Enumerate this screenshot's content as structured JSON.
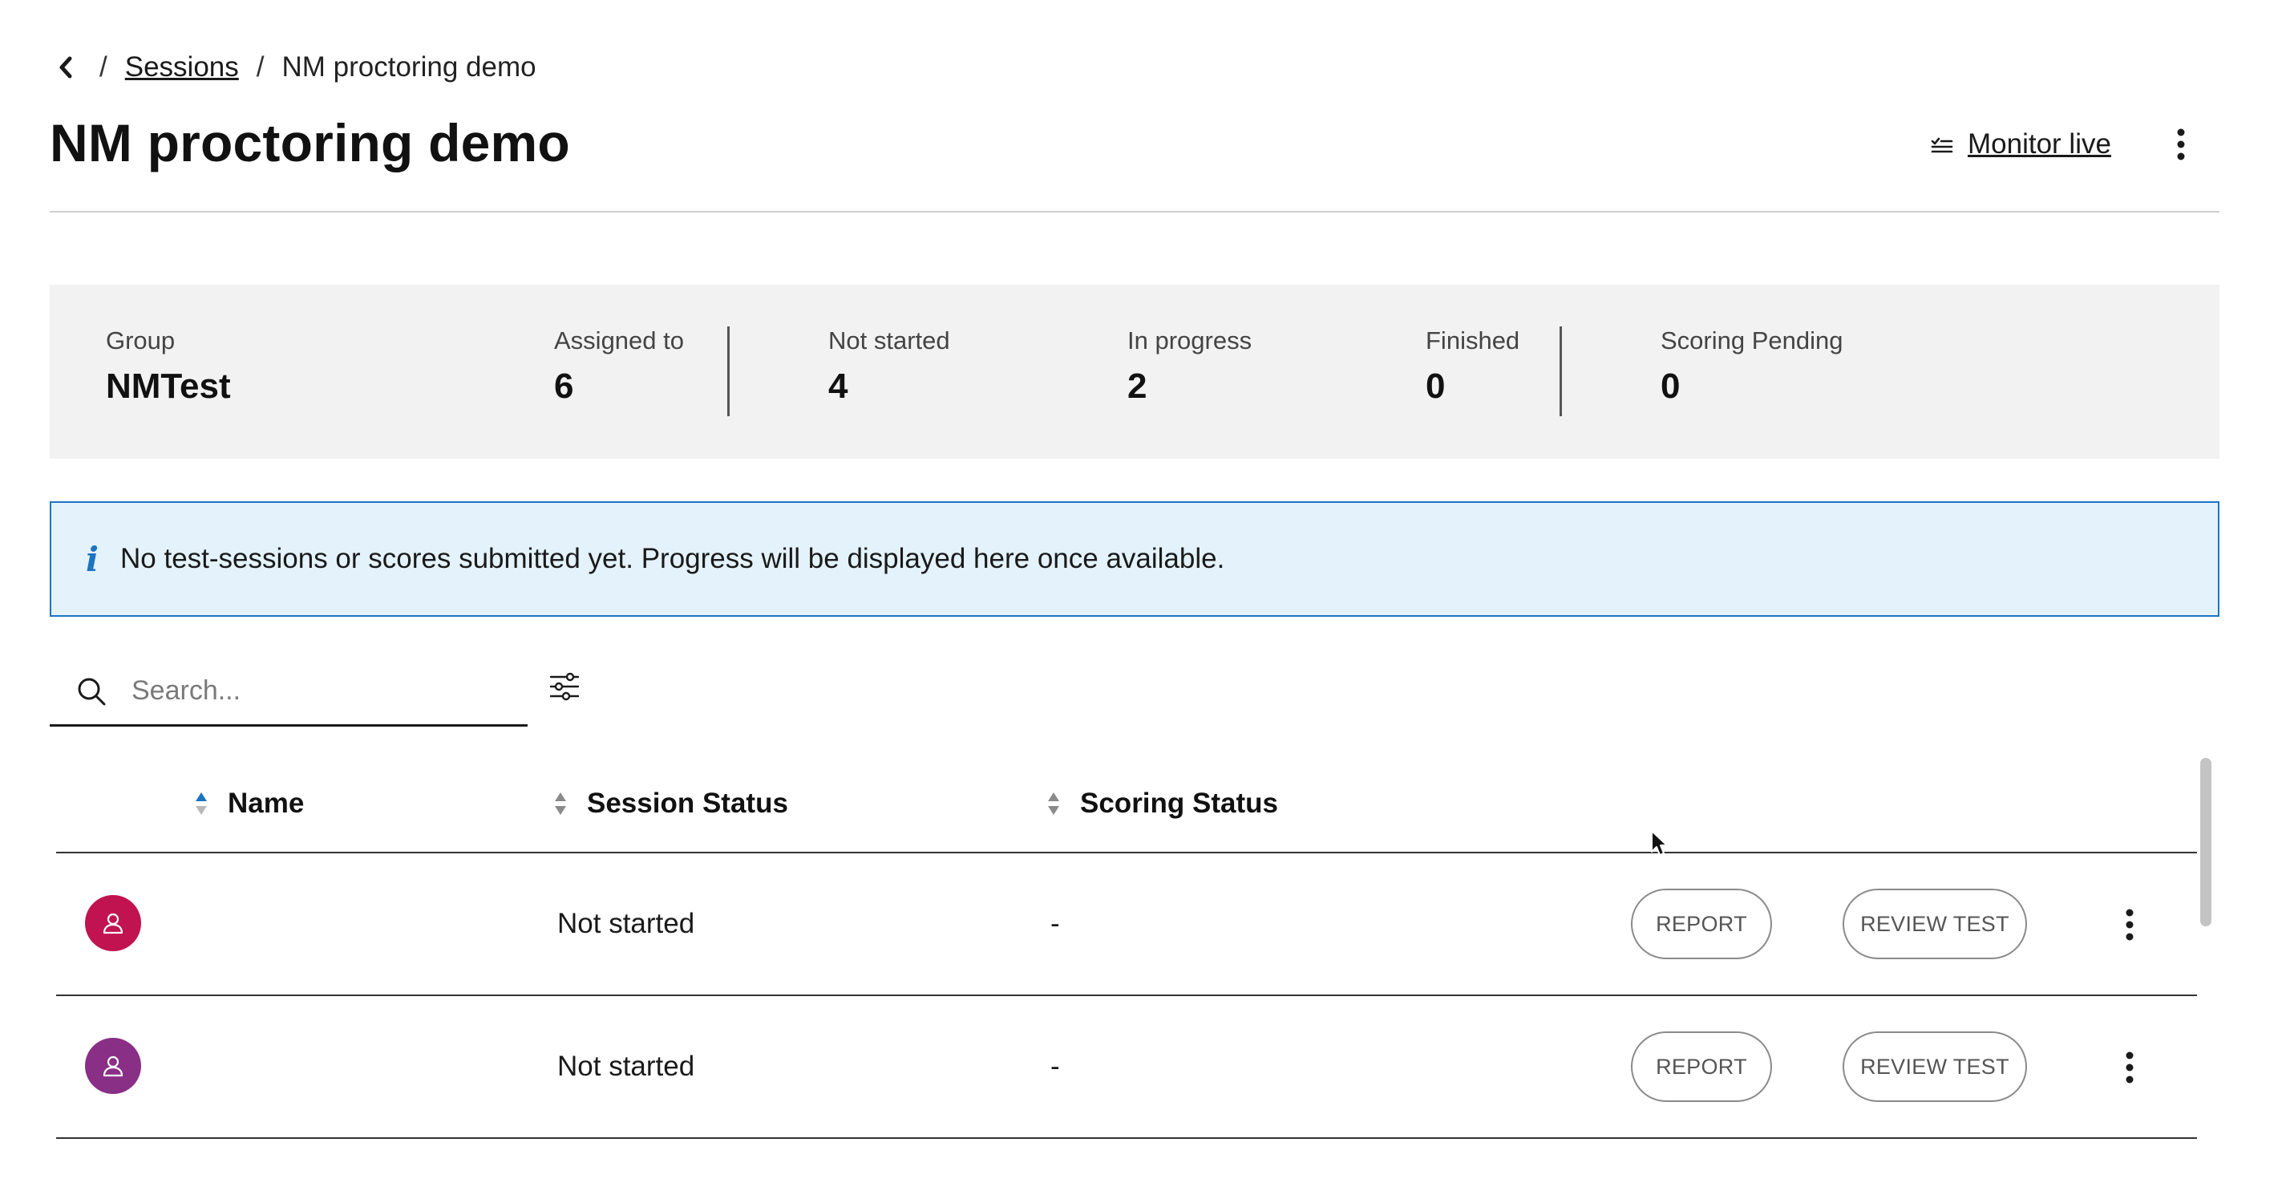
{
  "breadcrumb": {
    "sessions_label": "Sessions",
    "current_label": "NM proctoring demo"
  },
  "header": {
    "title": "NM proctoring demo",
    "monitor_live_label": "Monitor live"
  },
  "stats": {
    "group": {
      "label": "Group",
      "value": "NMTest"
    },
    "assigned": {
      "label": "Assigned to",
      "value": "6"
    },
    "not_started": {
      "label": "Not started",
      "value": "4"
    },
    "in_progress": {
      "label": "In progress",
      "value": "2"
    },
    "finished": {
      "label": "Finished",
      "value": "0"
    },
    "scoring_pending": {
      "label": "Scoring Pending",
      "value": "0"
    }
  },
  "info_banner": {
    "text": "No test-sessions or scores submitted yet. Progress will be displayed here once available."
  },
  "search": {
    "placeholder": "Search...",
    "value": ""
  },
  "table": {
    "columns": [
      {
        "label": "Name",
        "sort": "ascending"
      },
      {
        "label": "Session Status",
        "sort": "none"
      },
      {
        "label": "Scoring Status",
        "sort": "none"
      }
    ],
    "rows": [
      {
        "name": "",
        "session_status": "Not started",
        "scoring_status": "-",
        "avatar_color": "#c0134f",
        "report_label": "REPORT",
        "review_label": "REVIEW TEST"
      },
      {
        "name": "",
        "session_status": "Not started",
        "scoring_status": "-",
        "avatar_color": "#8a2f86",
        "report_label": "REPORT",
        "review_label": "REVIEW TEST"
      }
    ]
  },
  "colors": {
    "info_border": "#1d73c2",
    "info_background": "#e3f2fb",
    "stats_background": "#f2f2f2",
    "sort_active": "#1d73c2"
  },
  "icons": {
    "back": "chevron-left-icon",
    "monitor_live": "list-check-icon",
    "more": "kebab-menu-icon",
    "info": "info-icon",
    "search": "search-icon",
    "filter": "sliders-icon",
    "sort": "sort-icon",
    "avatar": "user-icon"
  }
}
